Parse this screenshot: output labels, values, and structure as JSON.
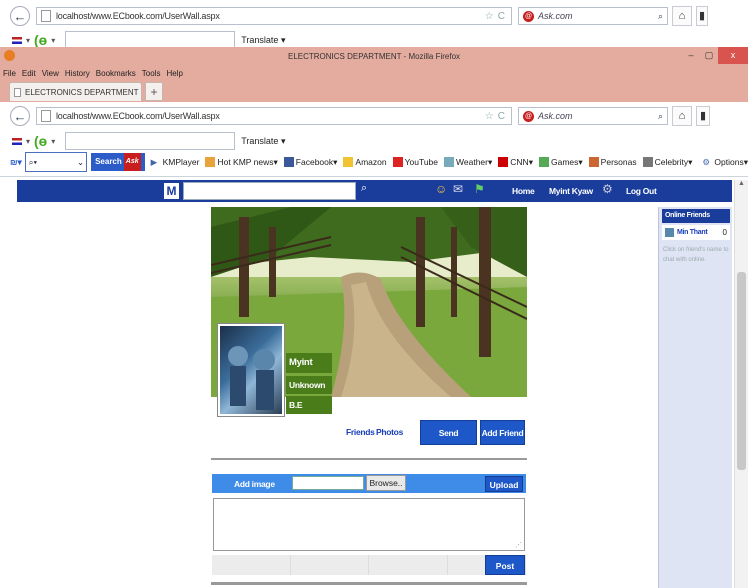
{
  "outer_browser": {
    "url": "localhost/www.ECbook.com/UserWall.aspx",
    "search_engine": "Ask.com",
    "translate_label": "Translate"
  },
  "window": {
    "title": "ELECTRONICS DEPARTMENT - Mozilla Firefox",
    "menu": [
      "File",
      "Edit",
      "View",
      "History",
      "Bookmarks",
      "Tools",
      "Help"
    ],
    "tab_label": "ELECTRONICS DEPARTMENT",
    "new_tab_glyph": "+",
    "close_glyph": "x",
    "minimize_glyph": "–",
    "maximize_glyph": "▢"
  },
  "inner_browser": {
    "url": "localhost/www.ECbook.com/UserWall.aspx",
    "search_engine": "Ask.com",
    "translate_label": "Translate"
  },
  "ask_toolbar": {
    "search_button": "Search",
    "ask_badge": "Ask",
    "items": [
      "KMPlayer",
      "Hot KMP news",
      "Facebook",
      "Amazon",
      "YouTube",
      "Weather",
      "CNN",
      "Games",
      "Personas",
      "Celebrity",
      "Options"
    ]
  },
  "site_nav": {
    "logo": "M",
    "links": [
      "Home",
      "Myint Kyaw",
      "Log Out"
    ]
  },
  "profile": {
    "name": "Myint Kyaw",
    "status": "Unknown",
    "degree": "B.E",
    "links": [
      "Friends",
      "Photos"
    ],
    "send_message": "Send Message",
    "add_friend": "Add Friend"
  },
  "composer": {
    "add_image": "Add image",
    "browse": "Browse..",
    "upload": "Upload",
    "post": "Post"
  },
  "online_friends": {
    "title": "Online Friends",
    "friends": [
      {
        "name": "Min Thant",
        "status": "0"
      }
    ],
    "hint": "Click on friend's name to chat with online."
  },
  "colors": {
    "nav_blue": "#1a3d9c",
    "button_blue": "#1e57c8",
    "profile_green": "#4a7d1a",
    "titlebar": "#e4ab9f"
  }
}
